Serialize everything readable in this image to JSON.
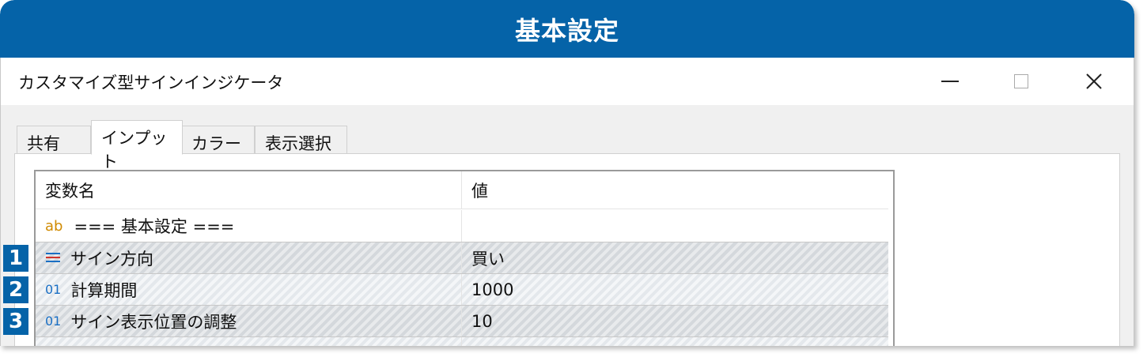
{
  "banner": {
    "title": "基本設定"
  },
  "window": {
    "title": "カスタマイズ型サインインジケータ",
    "controls": {
      "minimize": "—",
      "maximize": "☐",
      "close": "✕"
    }
  },
  "tabs": [
    {
      "label": "共有",
      "active": false
    },
    {
      "label": "インプット",
      "active": true
    },
    {
      "label": "カラー",
      "active": false
    },
    {
      "label": "表示選択",
      "active": false
    }
  ],
  "grid": {
    "columns": [
      "変数名",
      "値"
    ],
    "rows": [
      {
        "icon": "ab",
        "name": "=== 基本設定 ===",
        "value": ""
      },
      {
        "icon": "enum-icon",
        "badge": "1",
        "name": "サイン方向",
        "value": "買い"
      },
      {
        "icon": "01",
        "badge": "2",
        "name": "計算期間",
        "value": "1000"
      },
      {
        "icon": "01",
        "badge": "3",
        "name": "サイン表示位置の調整",
        "value": "10"
      }
    ]
  },
  "colors": {
    "accent": "#0563a8",
    "string_icon": "#d08a00",
    "number_icon": "#1a6fc4"
  }
}
